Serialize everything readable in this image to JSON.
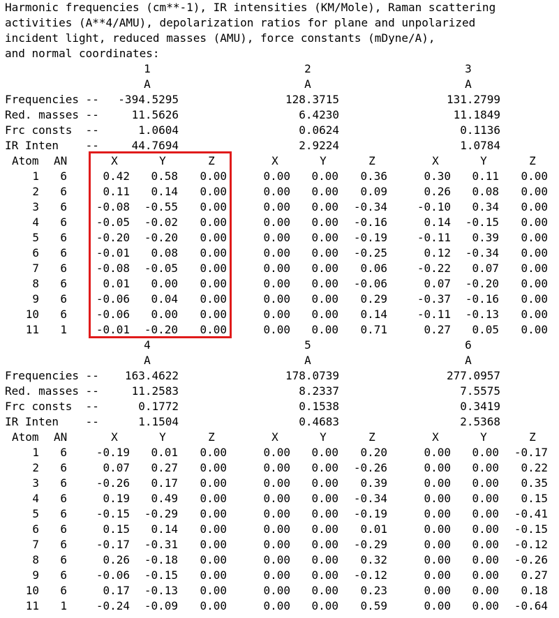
{
  "header_lines": [
    "Harmonic frequencies (cm**-1), IR intensities (KM/Mole), Raman scattering",
    "activities (A**4/AMU), depolarization ratios for plane and unpolarized",
    "incident light, reduced masses (AMU), force constants (mDyne/A),",
    "and normal coordinates:"
  ],
  "property_labels": {
    "frequencies": "Frequencies --",
    "red_masses": "Red. masses --",
    "frc_consts": "Frc consts  --",
    "ir_inten": "IR Inten    --"
  },
  "atom_header": {
    "atom": "Atom",
    "an": "AN",
    "x": "X",
    "y": "Y",
    "z": "Z"
  },
  "highlight_color": "#e01b1b",
  "blocks": [
    {
      "modes": [
        {
          "index": "1",
          "symmetry": "A",
          "frequency": "-394.5295",
          "red_mass": "11.5626",
          "frc_const": "1.0604",
          "ir_inten": "44.7694"
        },
        {
          "index": "2",
          "symmetry": "A",
          "frequency": "128.3715",
          "red_mass": "6.4230",
          "frc_const": "0.0624",
          "ir_inten": "2.9224"
        },
        {
          "index": "3",
          "symmetry": "A",
          "frequency": "131.2799",
          "red_mass": "11.1849",
          "frc_const": "0.1136",
          "ir_inten": "1.0784"
        }
      ],
      "rows": [
        {
          "atom": "1",
          "an": "6",
          "v": [
            "0.42",
            "0.58",
            "0.00",
            "0.00",
            "0.00",
            "0.36",
            "0.30",
            "0.11",
            "0.00"
          ]
        },
        {
          "atom": "2",
          "an": "6",
          "v": [
            "0.11",
            "0.14",
            "0.00",
            "0.00",
            "0.00",
            "0.09",
            "0.26",
            "0.08",
            "0.00"
          ]
        },
        {
          "atom": "3",
          "an": "6",
          "v": [
            "-0.08",
            "-0.55",
            "0.00",
            "0.00",
            "0.00",
            "-0.34",
            "-0.10",
            "0.34",
            "0.00"
          ]
        },
        {
          "atom": "4",
          "an": "6",
          "v": [
            "-0.05",
            "-0.02",
            "0.00",
            "0.00",
            "0.00",
            "-0.16",
            "0.14",
            "-0.15",
            "0.00"
          ]
        },
        {
          "atom": "5",
          "an": "6",
          "v": [
            "-0.20",
            "-0.20",
            "0.00",
            "0.00",
            "0.00",
            "-0.19",
            "-0.11",
            "0.39",
            "0.00"
          ]
        },
        {
          "atom": "6",
          "an": "6",
          "v": [
            "-0.01",
            "0.08",
            "0.00",
            "0.00",
            "0.00",
            "-0.25",
            "0.12",
            "-0.34",
            "0.00"
          ]
        },
        {
          "atom": "7",
          "an": "6",
          "v": [
            "-0.08",
            "-0.05",
            "0.00",
            "0.00",
            "0.00",
            "0.06",
            "-0.22",
            "0.07",
            "0.00"
          ]
        },
        {
          "atom": "8",
          "an": "6",
          "v": [
            "0.01",
            "0.00",
            "0.00",
            "0.00",
            "0.00",
            "-0.06",
            "0.07",
            "-0.20",
            "0.00"
          ]
        },
        {
          "atom": "9",
          "an": "6",
          "v": [
            "-0.06",
            "0.04",
            "0.00",
            "0.00",
            "0.00",
            "0.29",
            "-0.37",
            "-0.16",
            "0.00"
          ]
        },
        {
          "atom": "10",
          "an": "6",
          "v": [
            "-0.06",
            "0.00",
            "0.00",
            "0.00",
            "0.00",
            "0.14",
            "-0.11",
            "-0.13",
            "0.00"
          ]
        },
        {
          "atom": "11",
          "an": "1",
          "v": [
            "-0.01",
            "-0.20",
            "0.00",
            "0.00",
            "0.00",
            "0.71",
            "0.27",
            "0.05",
            "0.00"
          ]
        }
      ]
    },
    {
      "modes": [
        {
          "index": "4",
          "symmetry": "A",
          "frequency": "163.4622",
          "red_mass": "11.2583",
          "frc_const": "0.1772",
          "ir_inten": "1.1504"
        },
        {
          "index": "5",
          "symmetry": "A",
          "frequency": "178.0739",
          "red_mass": "8.2337",
          "frc_const": "0.1538",
          "ir_inten": "0.4683"
        },
        {
          "index": "6",
          "symmetry": "A",
          "frequency": "277.0957",
          "red_mass": "7.5575",
          "frc_const": "0.3419",
          "ir_inten": "2.5368"
        }
      ],
      "rows": [
        {
          "atom": "1",
          "an": "6",
          "v": [
            "-0.19",
            "0.01",
            "0.00",
            "0.00",
            "0.00",
            "0.20",
            "0.00",
            "0.00",
            "-0.17"
          ]
        },
        {
          "atom": "2",
          "an": "6",
          "v": [
            "0.07",
            "0.27",
            "0.00",
            "0.00",
            "0.00",
            "-0.26",
            "0.00",
            "0.00",
            "0.22"
          ]
        },
        {
          "atom": "3",
          "an": "6",
          "v": [
            "-0.26",
            "0.17",
            "0.00",
            "0.00",
            "0.00",
            "0.39",
            "0.00",
            "0.00",
            "0.35"
          ]
        },
        {
          "atom": "4",
          "an": "6",
          "v": [
            "0.19",
            "0.49",
            "0.00",
            "0.00",
            "0.00",
            "-0.34",
            "0.00",
            "0.00",
            "0.15"
          ]
        },
        {
          "atom": "5",
          "an": "6",
          "v": [
            "-0.15",
            "-0.29",
            "0.00",
            "0.00",
            "0.00",
            "-0.19",
            "0.00",
            "0.00",
            "-0.41"
          ]
        },
        {
          "atom": "6",
          "an": "6",
          "v": [
            "0.15",
            "0.14",
            "0.00",
            "0.00",
            "0.00",
            "0.01",
            "0.00",
            "0.00",
            "-0.15"
          ]
        },
        {
          "atom": "7",
          "an": "6",
          "v": [
            "-0.17",
            "-0.31",
            "0.00",
            "0.00",
            "0.00",
            "-0.29",
            "0.00",
            "0.00",
            "-0.12"
          ]
        },
        {
          "atom": "8",
          "an": "6",
          "v": [
            "0.26",
            "-0.18",
            "0.00",
            "0.00",
            "0.00",
            "0.32",
            "0.00",
            "0.00",
            "-0.26"
          ]
        },
        {
          "atom": "9",
          "an": "6",
          "v": [
            "-0.06",
            "-0.15",
            "0.00",
            "0.00",
            "0.00",
            "-0.12",
            "0.00",
            "0.00",
            "0.27"
          ]
        },
        {
          "atom": "10",
          "an": "6",
          "v": [
            "0.17",
            "-0.13",
            "0.00",
            "0.00",
            "0.00",
            "0.23",
            "0.00",
            "0.00",
            "0.18"
          ]
        },
        {
          "atom": "11",
          "an": "1",
          "v": [
            "-0.24",
            "-0.09",
            "0.00",
            "0.00",
            "0.00",
            "0.59",
            "0.00",
            "0.00",
            "-0.64"
          ]
        }
      ]
    }
  ]
}
